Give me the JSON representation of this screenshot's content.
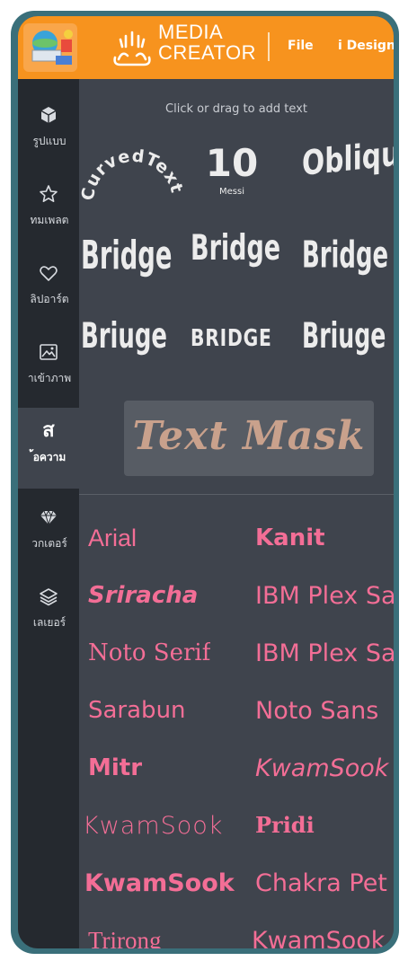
{
  "header": {
    "brand_line1": "MEDIA",
    "brand_line2": "CREATOR",
    "menu_file": "File",
    "menu_design": "i Design"
  },
  "sidebar": {
    "items": [
      {
        "label": "รูปแบบ",
        "icon": "cube-icon"
      },
      {
        "label": "ทมเพลต",
        "icon": "star-icon"
      },
      {
        "label": "ลิปอาร์ต",
        "icon": "heart-icon"
      },
      {
        "label": "าเข้าภาพ",
        "icon": "image-icon"
      },
      {
        "label": "้อความ",
        "icon": "text-thai-icon",
        "glyph": "ส",
        "active": true
      },
      {
        "label": "วกเตอร์",
        "icon": "diamond-icon"
      },
      {
        "label": "เลเยอร์",
        "icon": "layers-icon"
      }
    ]
  },
  "panel": {
    "hint": "Click or drag to add text",
    "effects": {
      "curved": "CurvedText",
      "number": "10",
      "number_sub": "Messi",
      "oblique": "Obliqu",
      "bridge_a": "Bridge",
      "bridge_b": "Bridge",
      "bridge_c": "Bridge",
      "bridge_d": "Briuge",
      "bridge_e": "BRIDGE",
      "bridge_f": "Briuge",
      "mask": "Text Mask"
    },
    "fonts": [
      {
        "left": "Arial",
        "right": "Kanit"
      },
      {
        "left": "Sriracha",
        "right": "IBM Plex Sa"
      },
      {
        "left": "Noto Serif",
        "right": "IBM Plex Sa"
      },
      {
        "left": "Sarabun",
        "right": "Noto Sans"
      },
      {
        "left": "Mitr",
        "right": "KwamSook"
      },
      {
        "left": "KwamSook",
        "right": "Pridi"
      },
      {
        "left": "KwamSook",
        "right": "Chakra Pet"
      },
      {
        "left": "Trirong",
        "right": "KwamSook"
      }
    ]
  },
  "colors": {
    "accent_orange": "#f7931e",
    "font_pink": "#f36e96",
    "sidebar_bg": "#25292f",
    "panel_bg": "#3f444d"
  }
}
